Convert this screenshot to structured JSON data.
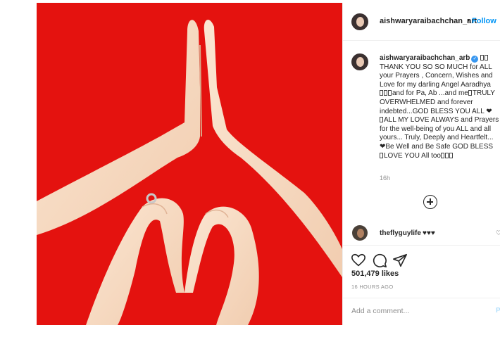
{
  "post": {
    "author": "aishwaryaraibachchan_art",
    "follow_label": "Follow",
    "separator": "•",
    "image_icon": "hands-heart-photo"
  },
  "caption": {
    "username": "aishwaryaraibachchan_arb",
    "verified_icon": "verified-badge-icon",
    "lines": [
      "THANK YOU SO SO MUCH for ALL",
      "your Prayers , Concern, Wishes and",
      "Love for my darling Angel Aaradhya",
      "and for Pa, Ab ...and me",
      "OVERWHELMED and forever",
      "indebted...GOD BLESS YOU ALL ❤",
      "ALL MY LOVE ALWAYS and Prayers",
      "for the well-being of you ALL and all",
      "yours... Truly, Deeply and Heartfelt...",
      "❤Be Well and Be Safe GOD BLESS",
      "LOVE YOU All too"
    ],
    "truly_word": "TRULY",
    "time": "16h"
  },
  "comments": [
    {
      "username": "theflyguylife",
      "text": "♥♥♥",
      "reply_icon": "heart-icon"
    }
  ],
  "actions": {
    "likes": "501,479 likes",
    "posted": "16 HOURS AGO",
    "comment_placeholder": "Add a comment...",
    "post_label": "P"
  },
  "colors": {
    "photo_background": "#e4120f",
    "link_blue": "#0095f6",
    "verified_blue": "#3897f0"
  }
}
